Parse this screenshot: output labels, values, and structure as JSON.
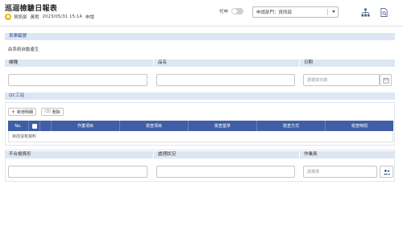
{
  "header": {
    "title": "巡迴檢驗日報表",
    "dept": "資訊部",
    "user": "黃宥",
    "datetime": "2023/05/31 15:14",
    "status": "申請",
    "toggle_label": "代申",
    "dept_select_value": "申請部門：資訊部"
  },
  "icons": {
    "org_chart": "sitemap-icon",
    "file_search": "file-search-icon",
    "calendar": "calendar-icon",
    "group": "user-group-icon"
  },
  "form_number": {
    "label": "表單編號",
    "value": "由系統自動產生"
  },
  "row1": {
    "machine_label": "機種",
    "product_label": "品名",
    "date_label": "日期",
    "date_placeholder": "請選擇日期"
  },
  "qc": {
    "label": "QC工站",
    "add_button": "新增明細",
    "delete_button": "刪除",
    "columns": [
      "No.",
      "",
      "作業項目",
      "檢查項目",
      "檢查基準",
      "檢查方式",
      "檢查時間"
    ],
    "empty_text": "目前沒有資料"
  },
  "row2": {
    "nonconform_label": "不合格情形",
    "handling_label": "處理狀況",
    "operator_label": "作業員",
    "operator_placeholder": "請選擇"
  },
  "colors": {
    "section_bg": "#dde6f3",
    "grid_header": "#3f5ea5",
    "add_icon": "#e53935"
  }
}
